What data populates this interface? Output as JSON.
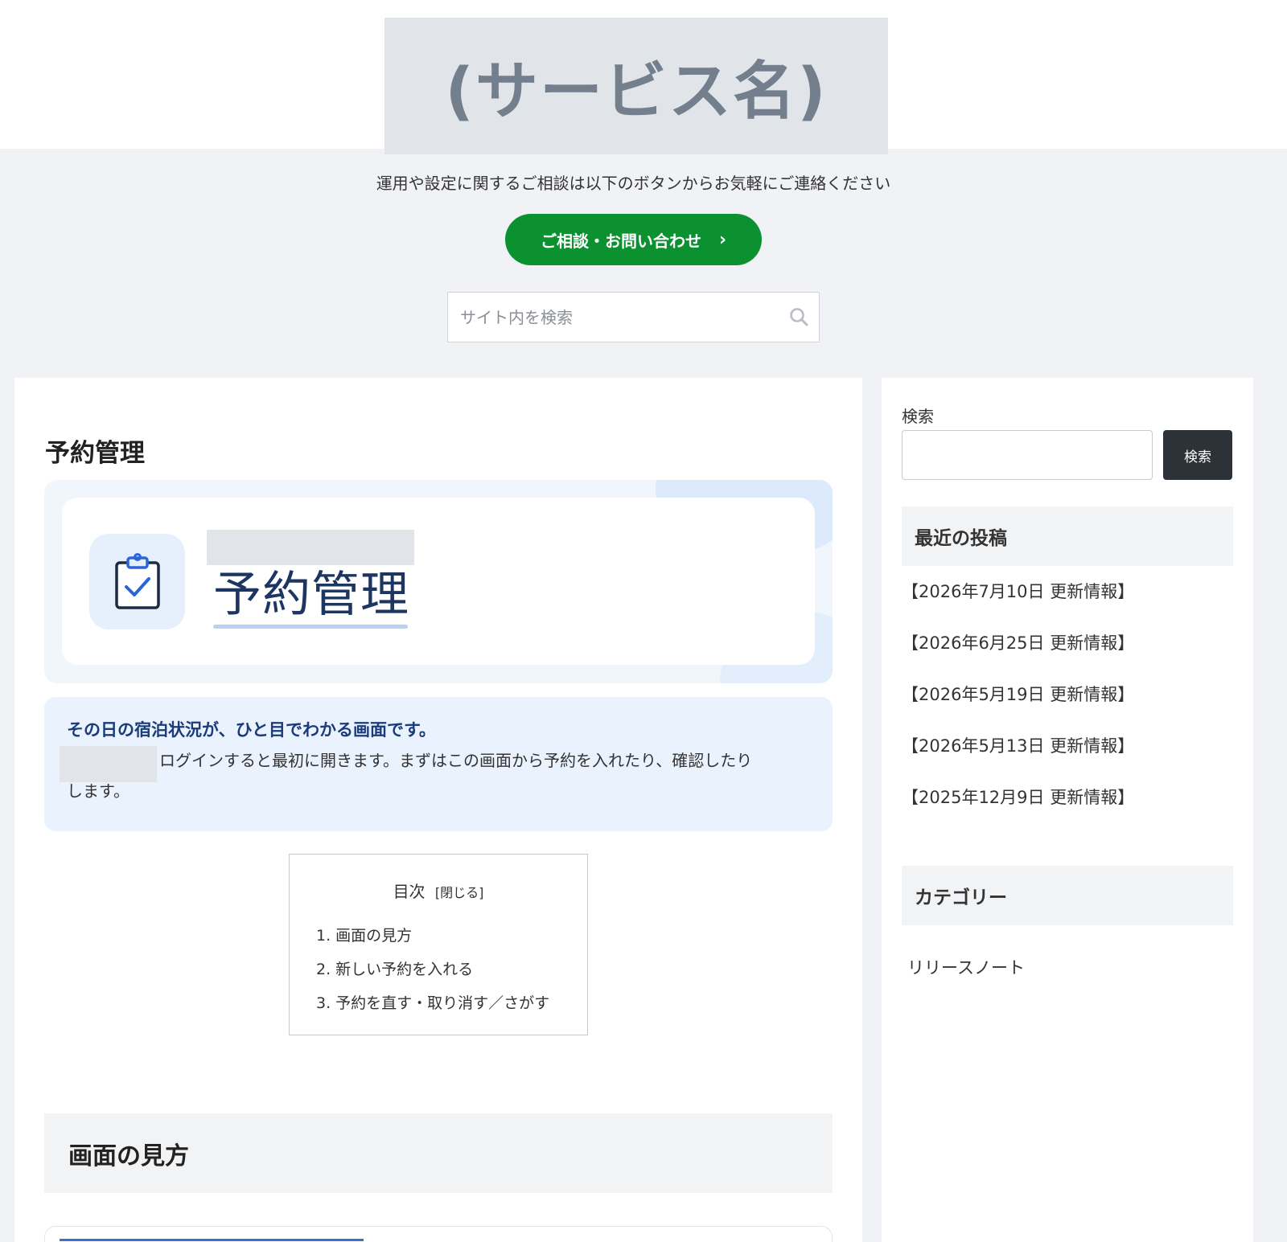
{
  "header": {
    "logo_text": "(サービス名)"
  },
  "contact": {
    "note": "運用や設定に関するご相談は以下のボタンからお気軽にご連絡ください",
    "button_label": "ご相談・お問い合わせ",
    "button_chevron": "›",
    "button_color": "#0b9130"
  },
  "site_search": {
    "placeholder": "サイト内を検索",
    "value": "",
    "icon": "search-icon"
  },
  "main": {
    "page_title": "予約管理",
    "hero": {
      "icon": "clipboard-check-icon",
      "title": "予約管理"
    },
    "lead": {
      "strong": "その日の宿泊状況が、ひと目でわかる画面です。",
      "body_line1": "ログインすると最初に開きます。まずはこの画面から予約を入れたり、確認したり",
      "body_line2": "します。"
    },
    "toc": {
      "title": "目次",
      "toggle": "[閉じる]",
      "items": [
        "1. 画面の見方",
        "2. 新しい予約を入れる",
        "3. 予約を直す・取り消す／さがす"
      ]
    },
    "section_title": "画面の見方"
  },
  "sidebar": {
    "search": {
      "label": "検索",
      "value": "",
      "button_label": "検索"
    },
    "recent_posts": {
      "title": "最近の投稿",
      "items": [
        "【2026年7月10日 更新情報】",
        "【2026年6月25日 更新情報】",
        "【2026年5月19日 更新情報】",
        "【2026年5月13日 更新情報】",
        "【2025年12月9日 更新情報】"
      ]
    },
    "categories": {
      "title": "カテゴリー",
      "items": [
        "リリースノート"
      ]
    }
  }
}
